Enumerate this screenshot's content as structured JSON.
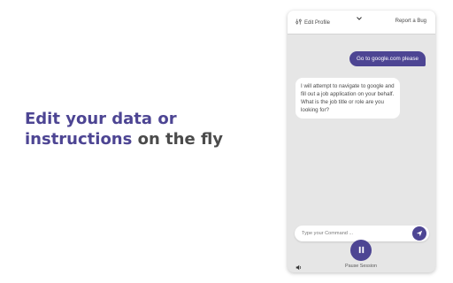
{
  "headline": {
    "accent_line1": "Edit your data or",
    "accent_line2": "instructions",
    "rest": " on the fly"
  },
  "colors": {
    "accent": "#4d4593",
    "panel_bg": "#e6e6e6",
    "text": "#4b4b4b"
  },
  "panel": {
    "topbar": {
      "edit_profile_label": "Edit Profile",
      "edit_profile_icon": "sliders-icon",
      "dropdown_icon": "chevron-down-icon",
      "report_bug_label": "Report a Bug"
    },
    "messages": [
      {
        "role": "user",
        "text": "Go to google.com please"
      },
      {
        "role": "assistant",
        "text": "I will attempt to navigate to google and fill out a job application on your behalf. What is the job title or role are you looking for?"
      }
    ],
    "command": {
      "placeholder": "Type your Command ...",
      "send_icon": "send-icon"
    },
    "controls": {
      "volume_icon": "volume-icon",
      "pause_icon": "pause-icon",
      "pause_label": "Pause Session"
    }
  }
}
